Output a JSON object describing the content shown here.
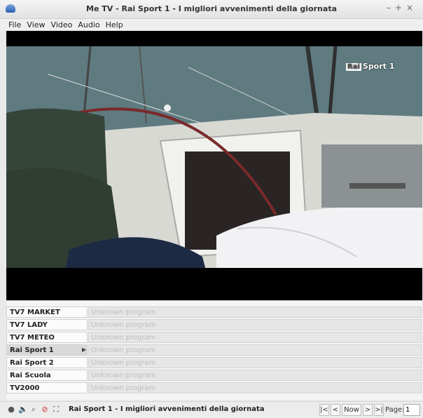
{
  "window": {
    "title": "Me TV - Rai Sport 1 - I migliori avvenimenti della giornata"
  },
  "menu": {
    "file": "File",
    "view": "View",
    "video": "Video",
    "audio": "Audio",
    "help": "Help"
  },
  "video": {
    "channel_logo_box": "Rai",
    "channel_logo_text": "Sport 1"
  },
  "epg": {
    "rows": [
      {
        "channel": "TV7 MARKET",
        "program": "Unknown program"
      },
      {
        "channel": "TV7 LADY",
        "program": "Unknown program"
      },
      {
        "channel": "TV7 METEO",
        "program": "Unknown program"
      },
      {
        "channel": "Rai Sport 1",
        "program": "Unknown program",
        "selected": true
      },
      {
        "channel": "Rai Sport 2",
        "program": "Unknown program"
      },
      {
        "channel": "Rai Scuola",
        "program": "Unknown program"
      },
      {
        "channel": "TV2000",
        "program": "Unknown program"
      }
    ]
  },
  "status": {
    "text": "Rai Sport 1 - I migliori avvenimenti della giornata",
    "now_label": "Now",
    "page_label": "Page:",
    "page_value": "1"
  }
}
